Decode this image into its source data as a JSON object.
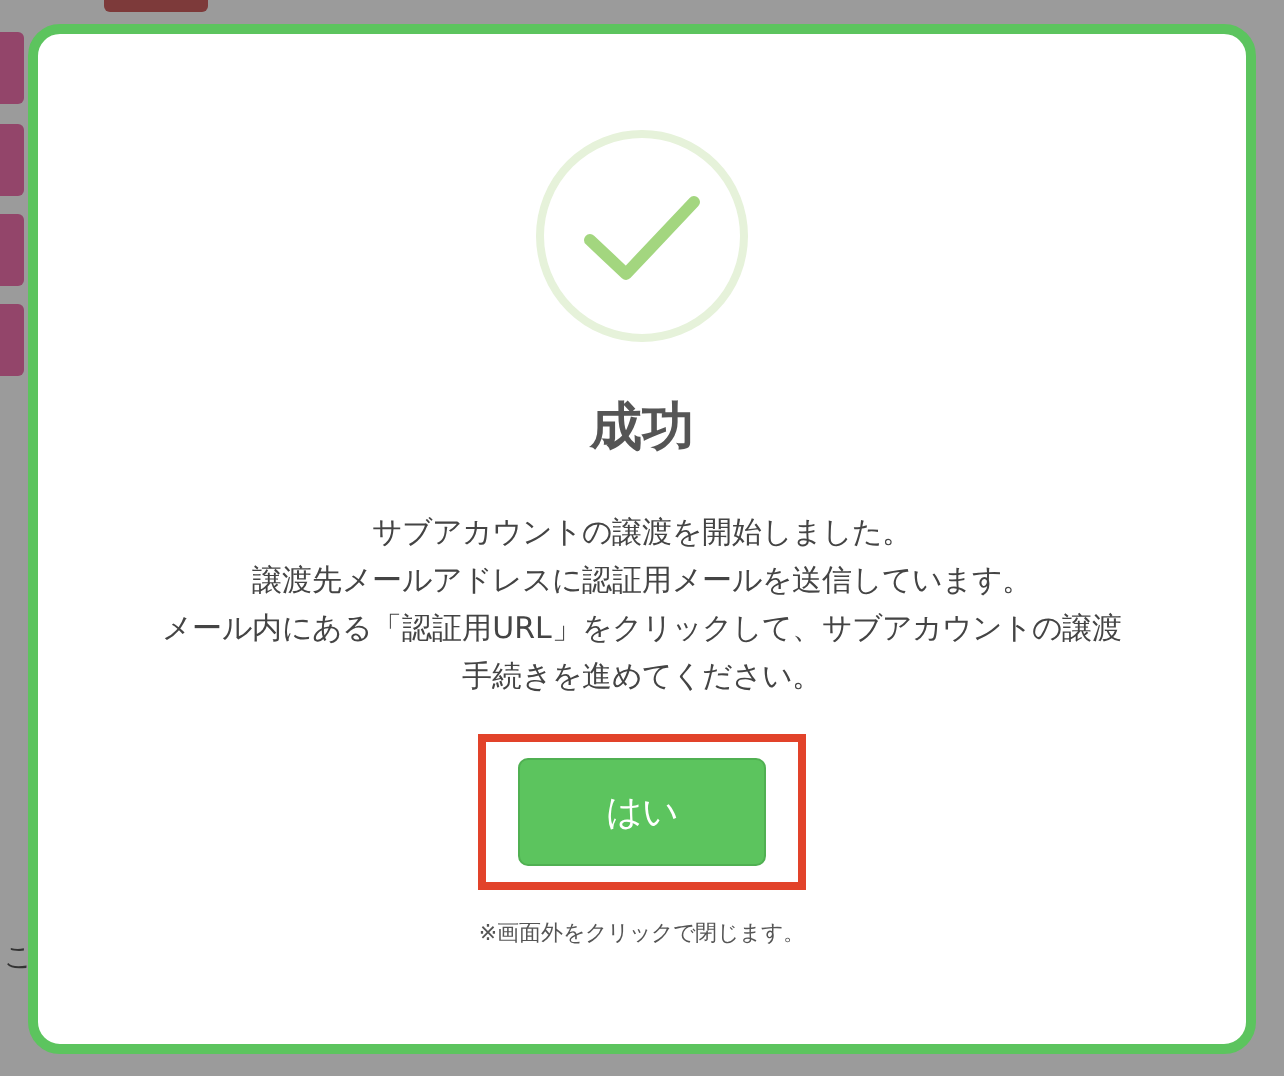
{
  "background": {
    "partial_text": "こ"
  },
  "dialog": {
    "title": "成功",
    "message_lines": [
      "サブアカウントの譲渡を開始しました。",
      "譲渡先メールアドレスに認証用メールを送信しています。",
      "メール内にある「認証用URL」をクリックして、サブアカウントの譲渡",
      "手続きを進めてください。"
    ],
    "button": {
      "label": "はい",
      "highlighted": true
    },
    "footnote": "※画面外をクリックで閉じます。"
  }
}
